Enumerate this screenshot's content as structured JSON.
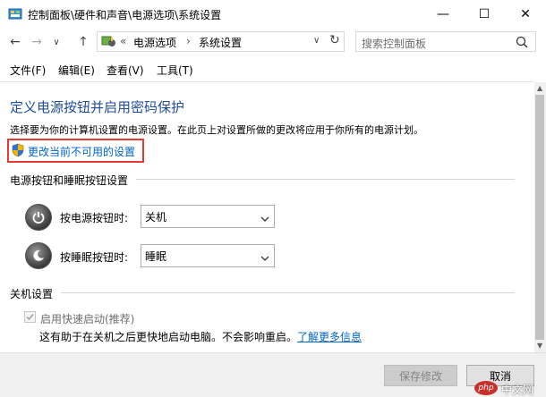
{
  "window": {
    "title": "控制面板\\硬件和声音\\电源选项\\系统设置",
    "minimize_glyph": "—",
    "maximize_glyph": "☐",
    "close_glyph": "✕"
  },
  "address": {
    "overflow": "«",
    "crumbs": [
      "电源选项",
      "系统设置"
    ],
    "separator": "›",
    "dropdown_glyph": "∨",
    "refresh_glyph": "↻",
    "back_glyph": "←",
    "forward_glyph": "→",
    "recent_glyph": "∨",
    "up_glyph": "↑"
  },
  "search": {
    "placeholder": "搜索控制面板"
  },
  "menu": [
    "文件(F)",
    "编辑(E)",
    "查看(V)",
    "工具(T)"
  ],
  "page": {
    "title": "定义电源按钮并启用密码保护",
    "description": "选择要为你的计算机设置的电源设置。在此页上对设置所做的更改将应用于你所有的电源计划。",
    "change_link": "更改当前不可用的设置"
  },
  "buttons_section": {
    "heading": "电源按钮和睡眠按钮设置",
    "power_label": "按电源按钮时:",
    "power_value": "关机",
    "sleep_label": "按睡眠按钮时:",
    "sleep_value": "睡眠"
  },
  "shutdown_section": {
    "heading": "关机设置",
    "fast_startup_label": "启用快速启动(推荐)",
    "fast_startup_desc": "这有助于在关机之后更快地启动电脑。不会影响重启。",
    "learn_more": "了解更多信息"
  },
  "footer": {
    "save": "保存修改",
    "cancel": "取消"
  },
  "watermark": {
    "text": "php",
    "site": "中文网"
  },
  "colors": {
    "title_blue": "#1e4e9c",
    "link_blue": "#0066cc",
    "highlight_red": "#e53935"
  }
}
